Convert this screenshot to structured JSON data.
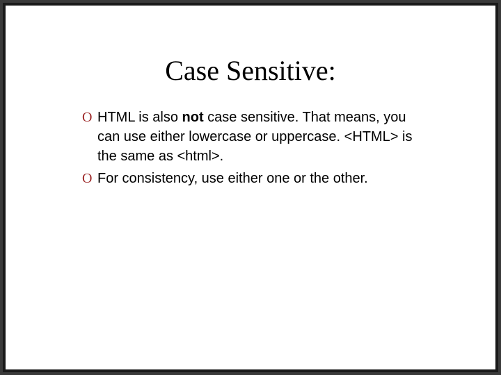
{
  "slide": {
    "title": "Case Sensitive:",
    "bullets": [
      {
        "marker": "O",
        "parts": {
          "pre": "HTML is also ",
          "bold": "not",
          "post": " case sensitive. That means, you can use either lowercase or uppercase. <HTML> is the same as <html>."
        }
      },
      {
        "marker": "O",
        "text": "For consistency, use either one or the other."
      }
    ]
  }
}
